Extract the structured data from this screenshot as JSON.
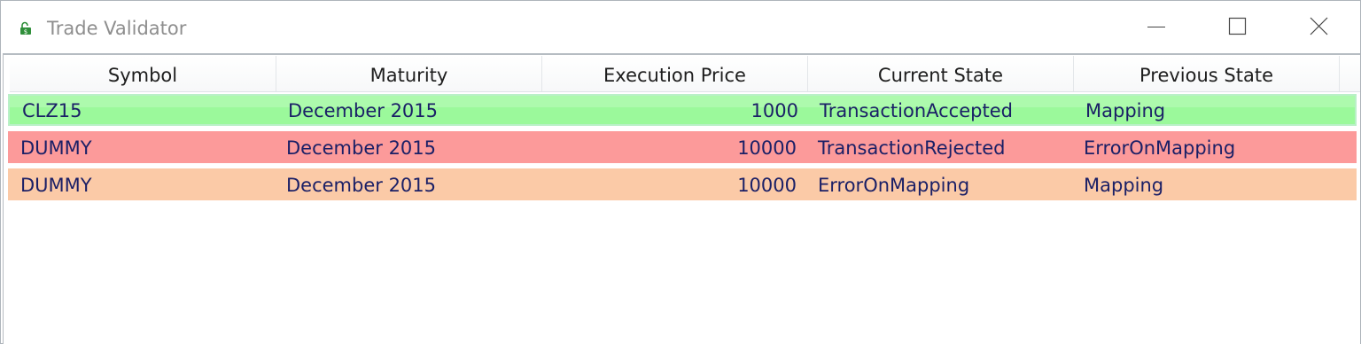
{
  "window": {
    "title": "Trade Validator",
    "controls": {
      "minimize_icon": "minimize-icon",
      "maximize_icon": "maximize-icon",
      "close_icon": "close-icon"
    }
  },
  "grid": {
    "columns": [
      "Symbol",
      "Maturity",
      "Execution Price",
      "Current State",
      "Previous State"
    ],
    "rows": [
      {
        "symbol": "CLZ15",
        "maturity": "December 2015",
        "execution_price": "1000",
        "current_state": "TransactionAccepted",
        "previous_state": "Mapping",
        "row_color": "#9bf99b"
      },
      {
        "symbol": "DUMMY",
        "maturity": "December 2015",
        "execution_price": "10000",
        "current_state": "TransactionRejected",
        "previous_state": "ErrorOnMapping",
        "row_color": "#fc9a9a"
      },
      {
        "symbol": "DUMMY",
        "maturity": "December 2015",
        "execution_price": "10000",
        "current_state": "ErrorOnMapping",
        "previous_state": "Mapping",
        "row_color": "#fbcaa7"
      }
    ]
  },
  "colors": {
    "text": "#1a1f66",
    "header_text": "#1d1d1d",
    "title_text": "#8e8e8e",
    "app_icon": "#2f8f3a"
  }
}
